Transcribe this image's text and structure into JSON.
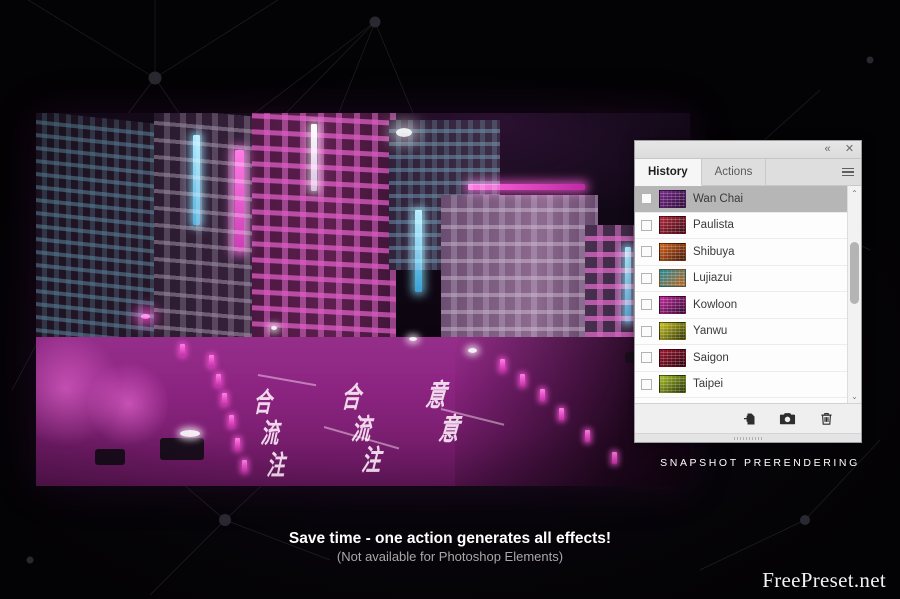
{
  "promo": {
    "snapshot_label": "SNAPSHOT PRERENDERING",
    "tagline_main": "Save time - one action generates all effects!",
    "tagline_sub": "(Not available for Photoshop Elements)",
    "watermark": "FreePreset.net"
  },
  "panel": {
    "collapse_icon": "«",
    "close_icon": "✕",
    "menu_icon": "panel-menu-icon",
    "tabs": [
      {
        "label": "History",
        "active": true
      },
      {
        "label": "Actions",
        "active": false
      }
    ],
    "scrollbar": {
      "up_arrow": "⌃",
      "down_arrow": "⌄"
    },
    "items": [
      {
        "name": "Wan Chai",
        "selected": true,
        "checked": false,
        "thumb_from": "#7a2a8e",
        "thumb_to": "#2a0c34"
      },
      {
        "name": "Paulista",
        "selected": false,
        "checked": false,
        "thumb_from": "#b32a3c",
        "thumb_to": "#3a0a16"
      },
      {
        "name": "Shibuya",
        "selected": false,
        "checked": false,
        "thumb_from": "#d4661e",
        "thumb_to": "#40160a"
      },
      {
        "name": "Lujiazui",
        "selected": false,
        "checked": false,
        "thumb_from": "#1e8a9c",
        "thumb_to": "#c2641c"
      },
      {
        "name": "Kowloon",
        "selected": false,
        "checked": false,
        "thumb_from": "#c42a9e",
        "thumb_to": "#2e0a2c"
      },
      {
        "name": "Yanwu",
        "selected": false,
        "checked": false,
        "thumb_from": "#c8c422",
        "thumb_to": "#2e3008"
      },
      {
        "name": "Saigon",
        "selected": false,
        "checked": false,
        "thumb_from": "#9e1830",
        "thumb_to": "#2a060e"
      },
      {
        "name": "Taipei",
        "selected": false,
        "checked": false,
        "thumb_from": "#a8c026",
        "thumb_to": "#26300a"
      }
    ],
    "footer_actions": [
      {
        "icon": "new-document-from-state-icon"
      },
      {
        "icon": "camera-snapshot-icon"
      },
      {
        "icon": "trash-icon"
      }
    ]
  },
  "photo": {
    "description": "night city street neon purple",
    "road_text": [
      "合",
      "流",
      "注",
      "意",
      "合",
      "流",
      "注",
      "意"
    ],
    "accent_magenta": "#e03cc8",
    "accent_cyan": "#7ae1ff"
  }
}
